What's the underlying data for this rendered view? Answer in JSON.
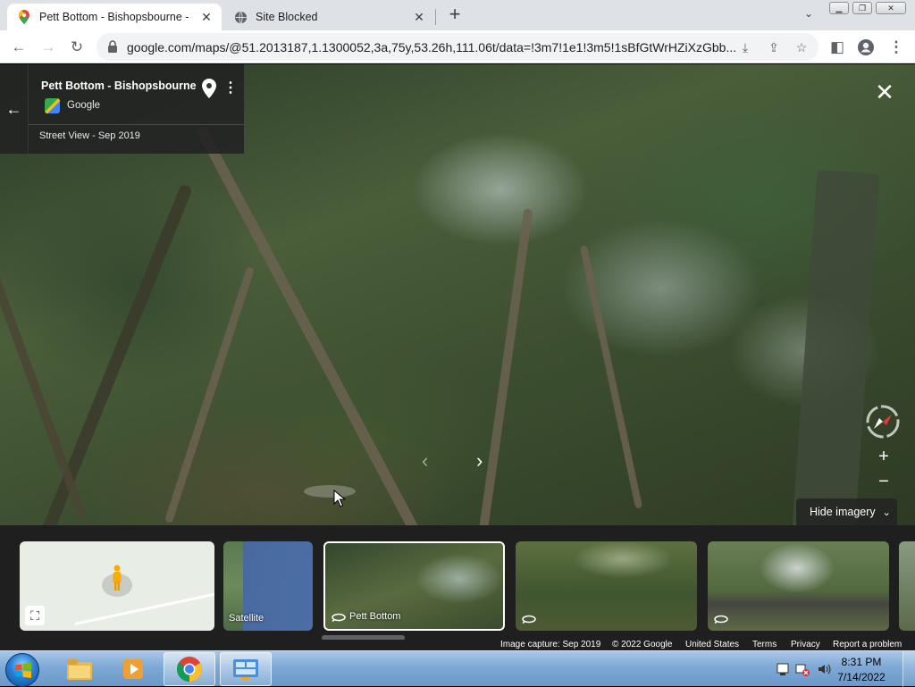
{
  "browser": {
    "tabs": [
      {
        "title": "Pett Bottom - Bishopsbourne - G",
        "icon": "google-maps-pin-icon",
        "active": true
      },
      {
        "title": "Site Blocked",
        "icon": "globe-icon",
        "active": false
      }
    ],
    "url": "google.com/maps/@51.2013187,1.1300052,3a,75y,53.26h,111.06t/data=!3m7!1e1!3m5!1sBfGtWrHZiXzGbb..."
  },
  "place_card": {
    "title": "Pett Bottom - Bishopsbourne",
    "source": "Google",
    "date": "Street View - Sep 2019"
  },
  "controls": {
    "hide_imagery": "Hide imagery",
    "zoom_in": "+",
    "zoom_out": "−"
  },
  "strip": {
    "satellite_label": "Satellite",
    "current_label": "Pett Bottom"
  },
  "footer": {
    "image_capture": "Image capture: Sep 2019",
    "copyright": "© 2022 Google",
    "region": "United States",
    "terms": "Terms",
    "privacy": "Privacy",
    "report": "Report a problem"
  },
  "taskbar": {
    "time": "8:31 PM",
    "date": "7/14/2022"
  },
  "colors": {
    "tabstrip": "#dee1e6",
    "panel": "#222222",
    "taskbar": "#7ea9d6"
  }
}
